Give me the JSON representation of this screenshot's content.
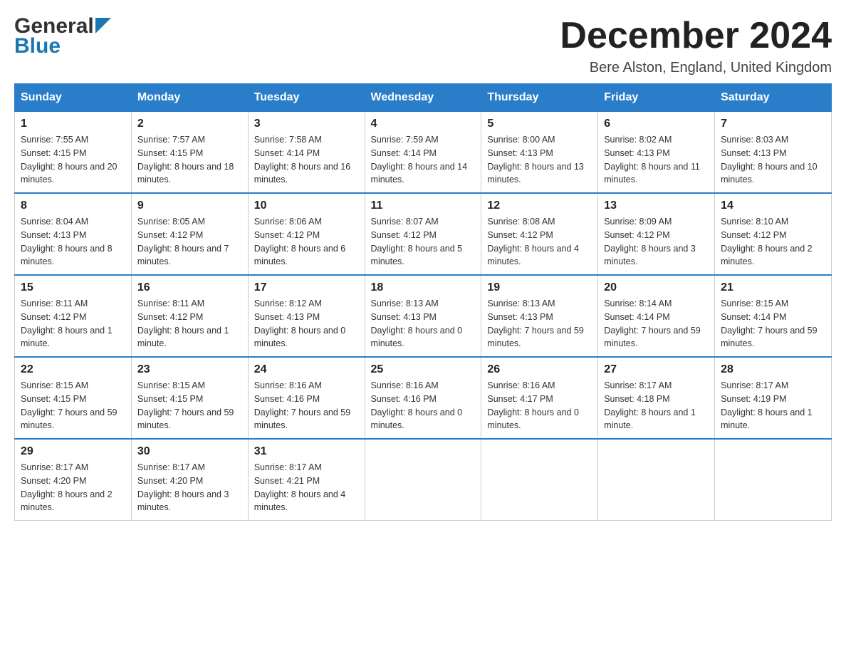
{
  "header": {
    "logo_general": "General",
    "logo_blue": "Blue",
    "month_title": "December 2024",
    "location": "Bere Alston, England, United Kingdom"
  },
  "days_of_week": [
    "Sunday",
    "Monday",
    "Tuesday",
    "Wednesday",
    "Thursday",
    "Friday",
    "Saturday"
  ],
  "weeks": [
    [
      {
        "day": "1",
        "sunrise": "7:55 AM",
        "sunset": "4:15 PM",
        "daylight": "8 hours and 20 minutes."
      },
      {
        "day": "2",
        "sunrise": "7:57 AM",
        "sunset": "4:15 PM",
        "daylight": "8 hours and 18 minutes."
      },
      {
        "day": "3",
        "sunrise": "7:58 AM",
        "sunset": "4:14 PM",
        "daylight": "8 hours and 16 minutes."
      },
      {
        "day": "4",
        "sunrise": "7:59 AM",
        "sunset": "4:14 PM",
        "daylight": "8 hours and 14 minutes."
      },
      {
        "day": "5",
        "sunrise": "8:00 AM",
        "sunset": "4:13 PM",
        "daylight": "8 hours and 13 minutes."
      },
      {
        "day": "6",
        "sunrise": "8:02 AM",
        "sunset": "4:13 PM",
        "daylight": "8 hours and 11 minutes."
      },
      {
        "day": "7",
        "sunrise": "8:03 AM",
        "sunset": "4:13 PM",
        "daylight": "8 hours and 10 minutes."
      }
    ],
    [
      {
        "day": "8",
        "sunrise": "8:04 AM",
        "sunset": "4:13 PM",
        "daylight": "8 hours and 8 minutes."
      },
      {
        "day": "9",
        "sunrise": "8:05 AM",
        "sunset": "4:12 PM",
        "daylight": "8 hours and 7 minutes."
      },
      {
        "day": "10",
        "sunrise": "8:06 AM",
        "sunset": "4:12 PM",
        "daylight": "8 hours and 6 minutes."
      },
      {
        "day": "11",
        "sunrise": "8:07 AM",
        "sunset": "4:12 PM",
        "daylight": "8 hours and 5 minutes."
      },
      {
        "day": "12",
        "sunrise": "8:08 AM",
        "sunset": "4:12 PM",
        "daylight": "8 hours and 4 minutes."
      },
      {
        "day": "13",
        "sunrise": "8:09 AM",
        "sunset": "4:12 PM",
        "daylight": "8 hours and 3 minutes."
      },
      {
        "day": "14",
        "sunrise": "8:10 AM",
        "sunset": "4:12 PM",
        "daylight": "8 hours and 2 minutes."
      }
    ],
    [
      {
        "day": "15",
        "sunrise": "8:11 AM",
        "sunset": "4:12 PM",
        "daylight": "8 hours and 1 minute."
      },
      {
        "day": "16",
        "sunrise": "8:11 AM",
        "sunset": "4:12 PM",
        "daylight": "8 hours and 1 minute."
      },
      {
        "day": "17",
        "sunrise": "8:12 AM",
        "sunset": "4:13 PM",
        "daylight": "8 hours and 0 minutes."
      },
      {
        "day": "18",
        "sunrise": "8:13 AM",
        "sunset": "4:13 PM",
        "daylight": "8 hours and 0 minutes."
      },
      {
        "day": "19",
        "sunrise": "8:13 AM",
        "sunset": "4:13 PM",
        "daylight": "7 hours and 59 minutes."
      },
      {
        "day": "20",
        "sunrise": "8:14 AM",
        "sunset": "4:14 PM",
        "daylight": "7 hours and 59 minutes."
      },
      {
        "day": "21",
        "sunrise": "8:15 AM",
        "sunset": "4:14 PM",
        "daylight": "7 hours and 59 minutes."
      }
    ],
    [
      {
        "day": "22",
        "sunrise": "8:15 AM",
        "sunset": "4:15 PM",
        "daylight": "7 hours and 59 minutes."
      },
      {
        "day": "23",
        "sunrise": "8:15 AM",
        "sunset": "4:15 PM",
        "daylight": "7 hours and 59 minutes."
      },
      {
        "day": "24",
        "sunrise": "8:16 AM",
        "sunset": "4:16 PM",
        "daylight": "7 hours and 59 minutes."
      },
      {
        "day": "25",
        "sunrise": "8:16 AM",
        "sunset": "4:16 PM",
        "daylight": "8 hours and 0 minutes."
      },
      {
        "day": "26",
        "sunrise": "8:16 AM",
        "sunset": "4:17 PM",
        "daylight": "8 hours and 0 minutes."
      },
      {
        "day": "27",
        "sunrise": "8:17 AM",
        "sunset": "4:18 PM",
        "daylight": "8 hours and 1 minute."
      },
      {
        "day": "28",
        "sunrise": "8:17 AM",
        "sunset": "4:19 PM",
        "daylight": "8 hours and 1 minute."
      }
    ],
    [
      {
        "day": "29",
        "sunrise": "8:17 AM",
        "sunset": "4:20 PM",
        "daylight": "8 hours and 2 minutes."
      },
      {
        "day": "30",
        "sunrise": "8:17 AM",
        "sunset": "4:20 PM",
        "daylight": "8 hours and 3 minutes."
      },
      {
        "day": "31",
        "sunrise": "8:17 AM",
        "sunset": "4:21 PM",
        "daylight": "8 hours and 4 minutes."
      },
      null,
      null,
      null,
      null
    ]
  ]
}
